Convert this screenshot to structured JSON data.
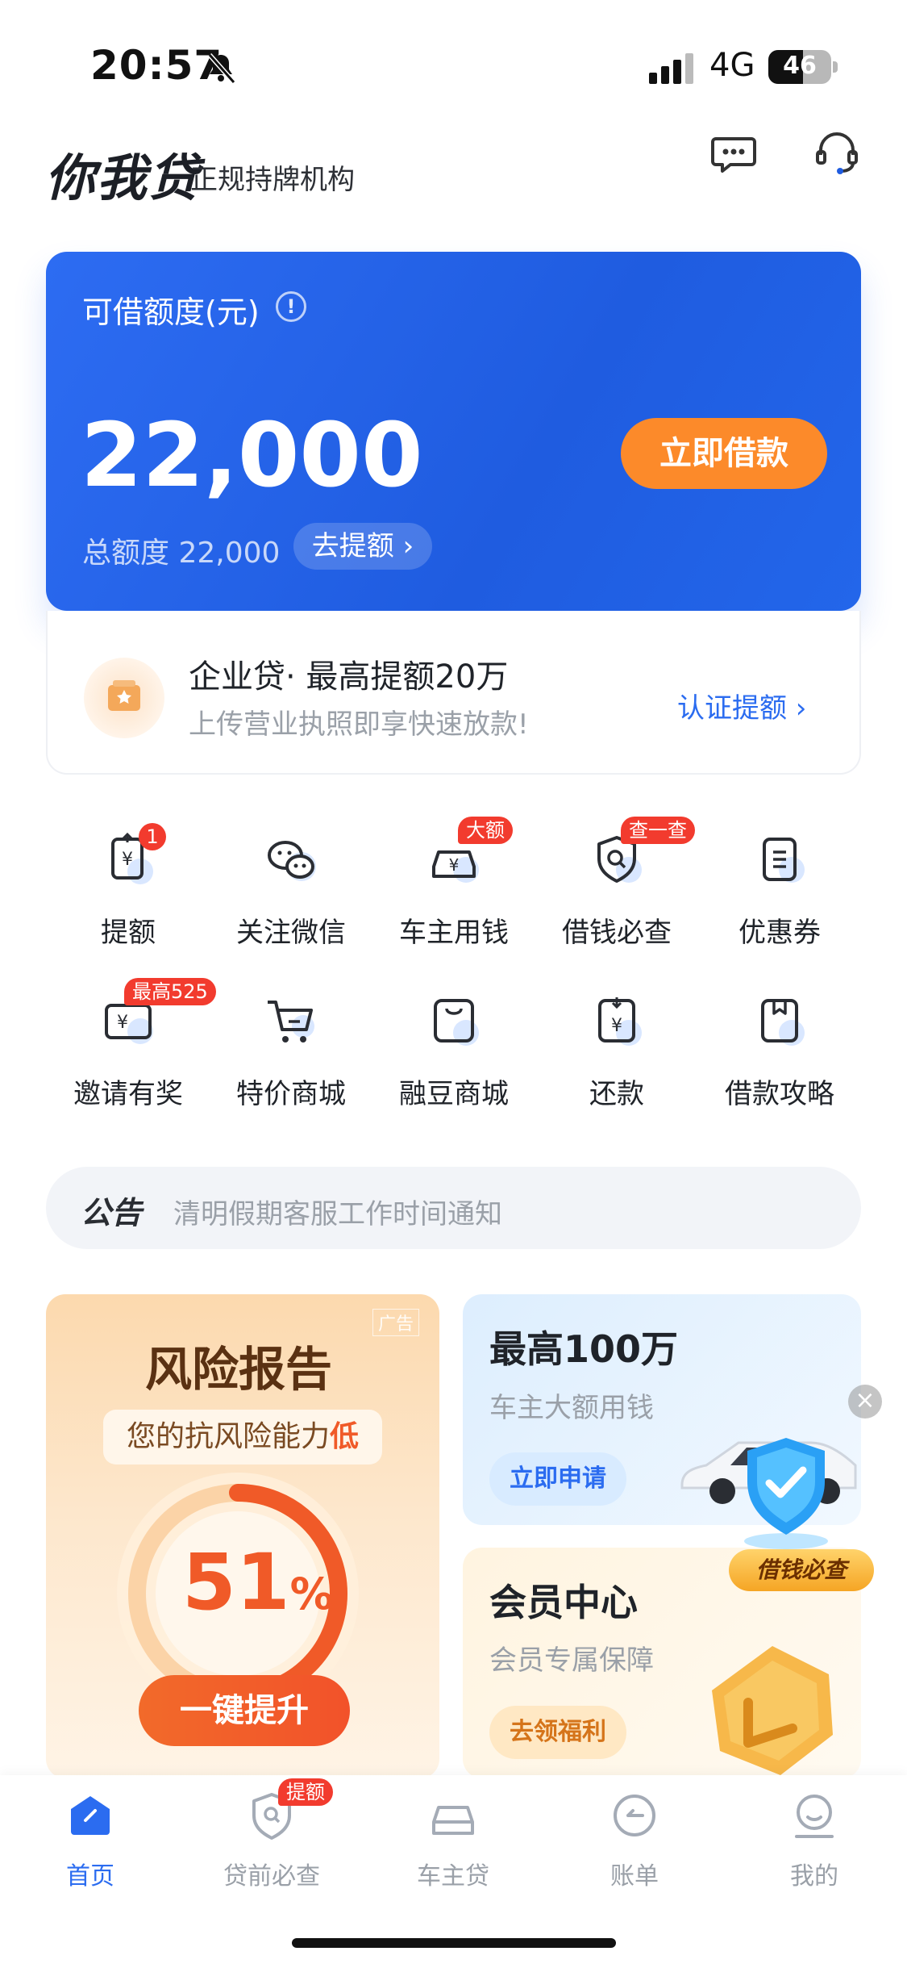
{
  "status_bar": {
    "time": "20:57",
    "network": "4G",
    "battery": "46"
  },
  "header": {
    "logo": "你我贷",
    "subtitle": "正规持牌机构"
  },
  "credit_card": {
    "label": "可借额度(元)",
    "info": "!",
    "amount": "22,000",
    "borrow_button": "立即借款",
    "total_label": "总额度 22,000",
    "raise_button": "去提额 ›"
  },
  "enterprise": {
    "title": "企业贷· 最高提额20万",
    "desc": "上传营业执照即享快速放款!",
    "link": "认证提额 ›"
  },
  "grid": [
    {
      "label": "提额",
      "badge": "1",
      "icon": "raise-limit-icon"
    },
    {
      "label": "关注微信",
      "badge": "",
      "icon": "wechat-icon"
    },
    {
      "label": "车主用钱",
      "badge": "大额",
      "icon": "car-money-icon"
    },
    {
      "label": "借钱必查",
      "badge": "查一查",
      "icon": "shield-check-icon"
    },
    {
      "label": "优惠券",
      "badge": "",
      "icon": "coupon-icon"
    },
    {
      "label": "邀请有奖",
      "badge": "最高525",
      "icon": "invite-icon"
    },
    {
      "label": "特价商城",
      "badge": "",
      "icon": "cart-icon"
    },
    {
      "label": "融豆商城",
      "badge": "",
      "icon": "bag-icon"
    },
    {
      "label": "还款",
      "badge": "",
      "icon": "repay-icon"
    },
    {
      "label": "借款攻略",
      "badge": "",
      "icon": "guide-icon"
    }
  ],
  "notice": {
    "tag": "公告",
    "text": "清明假期客服工作时间通知"
  },
  "risk_card": {
    "ad": "广告",
    "title": "风险报告",
    "sub_prefix": "您的抗风险能力",
    "sub_emph": "低",
    "percent": "51",
    "percent_unit": "%",
    "percent_value": 0.51,
    "button": "一键提升"
  },
  "car_card": {
    "title": "最高100万",
    "sub": "车主大额用钱",
    "button": "立即申请"
  },
  "vip_card": {
    "title": "会员中心",
    "sub": "会员专属保障",
    "button": "去领福利"
  },
  "floating": {
    "label": "借钱必查",
    "close": "×"
  },
  "tabs": [
    {
      "label": "首页",
      "badge": "",
      "icon": "home-icon",
      "active": true
    },
    {
      "label": "贷前必查",
      "badge": "提额",
      "icon": "precheck-icon",
      "active": false
    },
    {
      "label": "车主贷",
      "badge": "",
      "icon": "car-loan-icon",
      "active": false
    },
    {
      "label": "账单",
      "badge": "",
      "icon": "bill-icon",
      "active": false
    },
    {
      "label": "我的",
      "badge": "",
      "icon": "profile-icon",
      "active": false
    }
  ],
  "colors": {
    "primary": "#2b6cf0",
    "accent": "#fc8a2a",
    "badge": "#f23b2e"
  }
}
